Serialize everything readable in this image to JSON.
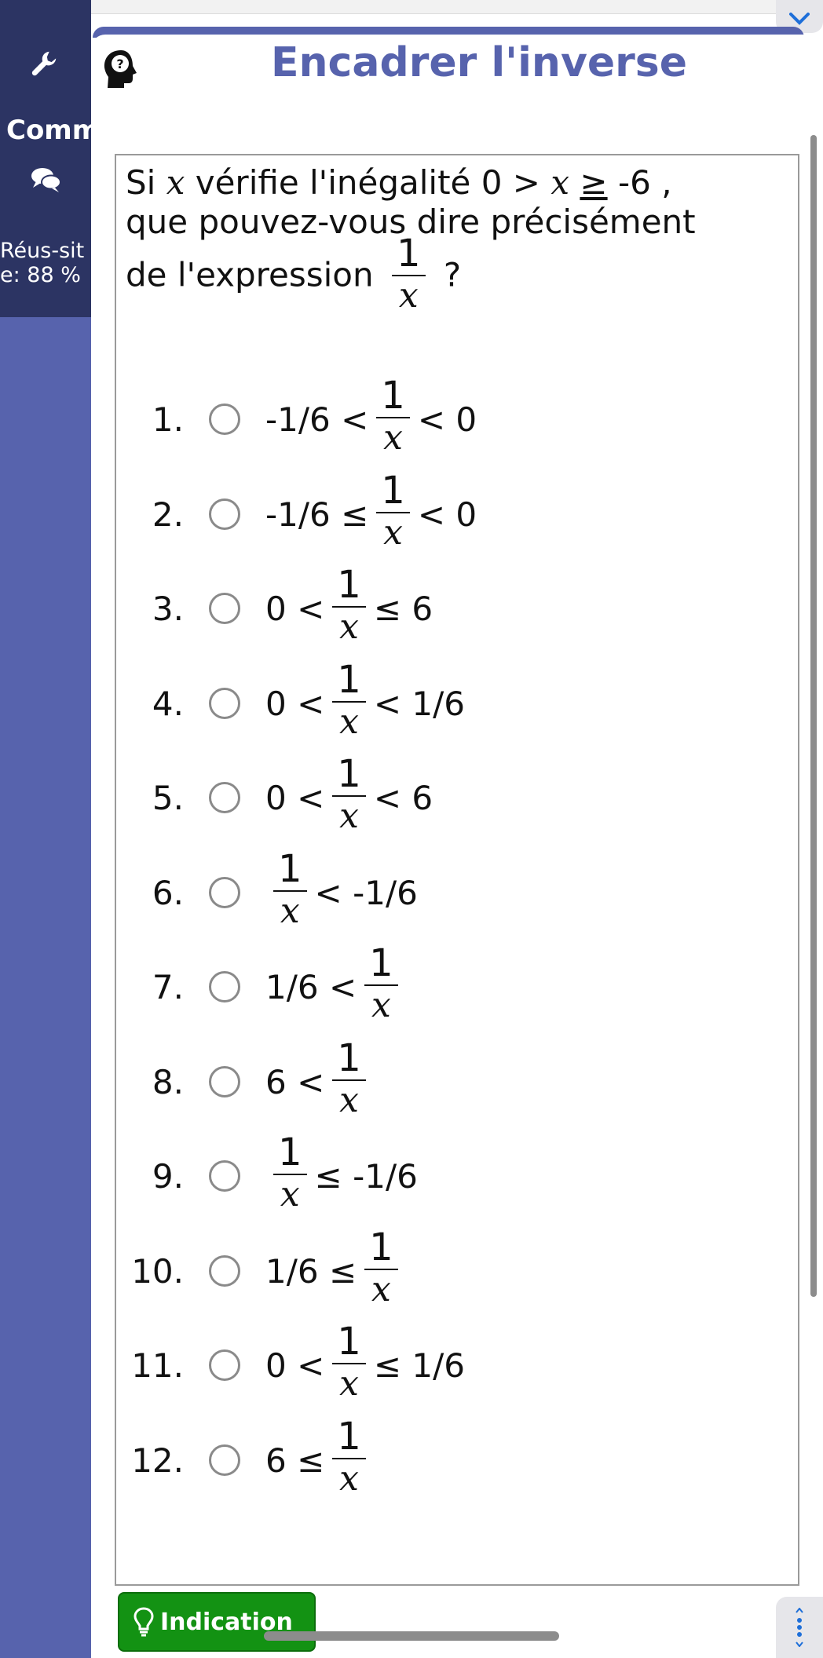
{
  "colors": {
    "sidebar": "#5763ad",
    "sidebar_dark": "#2c3463",
    "title": "#5763ad",
    "hint_button": "#139213",
    "link_blue": "#1e6fd9"
  },
  "sidebar": {
    "label": "Comm",
    "score": "Réus-site: 88 %",
    "icons": [
      "wrench-icon",
      "chat-icon"
    ]
  },
  "exercise": {
    "title": "Encadrer l'inverse",
    "help_icon": "head-question-icon"
  },
  "question": {
    "line1_a": "Si ",
    "var": "x",
    "line1_b": " vérifie l'inégalité 0 > ",
    "geq": "≥",
    "line1_c": " -6 ,",
    "line2": "que pouvez-vous dire précisément",
    "line3": "de l'expression ",
    "line3_end": " ?",
    "frac_num": "1",
    "frac_den": "x"
  },
  "options": [
    {
      "number": "1.",
      "before": "-1/6 <",
      "after": "< 0"
    },
    {
      "number": "2.",
      "before": "-1/6 ≤",
      "after": "< 0"
    },
    {
      "number": "3.",
      "before": "0 <",
      "after": "≤ 6"
    },
    {
      "number": "4.",
      "before": "0 <",
      "after": "< 1/6"
    },
    {
      "number": "5.",
      "before": "0 <",
      "after": "< 6"
    },
    {
      "number": "6.",
      "before": "",
      "after": "< -1/6"
    },
    {
      "number": "7.",
      "before": "1/6 <",
      "after": ""
    },
    {
      "number": "8.",
      "before": "6 <",
      "after": ""
    },
    {
      "number": "9.",
      "before": "",
      "after": "≤ -1/6"
    },
    {
      "number": "10.",
      "before": "1/6 ≤",
      "after": ""
    },
    {
      "number": "11.",
      "before": "0 <",
      "after": "≤ 1/6"
    },
    {
      "number": "12.",
      "before": "6 ≤",
      "after": ""
    }
  ],
  "hint": {
    "label": "Indication",
    "icon": "lightbulb-icon"
  }
}
